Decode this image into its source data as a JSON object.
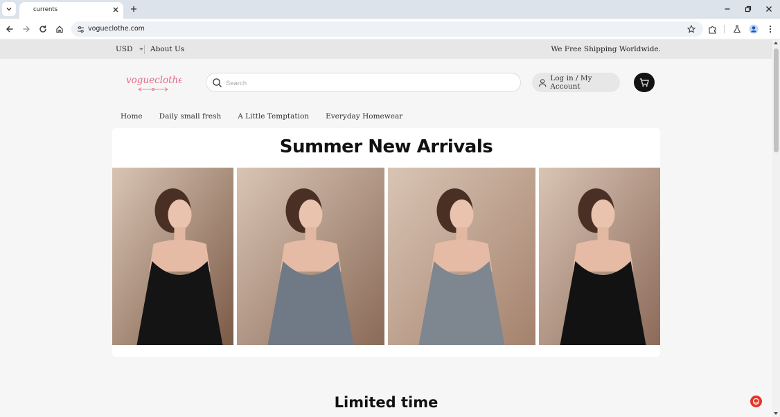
{
  "browser": {
    "tab_title": "currents",
    "url": "vogueclothe.com"
  },
  "announcement": {
    "currency": "USD",
    "about_label": "About Us",
    "shipping_text": "We Free Shipping Worldwide."
  },
  "header": {
    "logo_text": "vogueclothes",
    "search_placeholder": "Search",
    "login_label": "Log in / My Account"
  },
  "nav": {
    "items": [
      {
        "label": "Home"
      },
      {
        "label": "Daily small fresh"
      },
      {
        "label": "A Little Temptation"
      },
      {
        "label": "Everyday Homewear"
      }
    ]
  },
  "hero": {
    "title": "Summer New Arrivals",
    "photos": [
      {
        "dress_color": "#141414",
        "bg_color": "#7b5a46"
      },
      {
        "dress_color": "#6f7a86",
        "bg_color": "#8a6a58"
      },
      {
        "dress_color": "#7e8690",
        "bg_color": "#a4826d"
      },
      {
        "dress_color": "#121212",
        "bg_color": "#8c6a5a"
      }
    ]
  },
  "section2": {
    "title": "Limited time"
  },
  "colors": {
    "brand_pink": "#e06b86",
    "cart_bg": "#121212",
    "announce_bg": "#e7e7e7",
    "chat_red": "#e5352a"
  }
}
